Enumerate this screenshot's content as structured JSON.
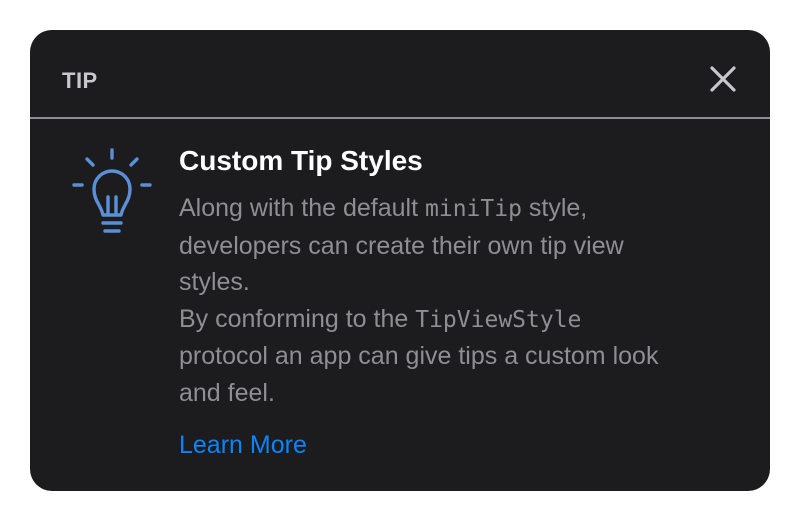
{
  "tip": {
    "header_label": "TIP",
    "close_icon": "close-icon",
    "icon": "lightbulb-icon",
    "title": "Custom Tip Styles",
    "body": {
      "p1_line1_pre": "Along with the default ",
      "p1_line1_code": "miniTip",
      "p1_line1_post": " style,",
      "p1_line2": "developers can create their own tip view",
      "p1_line3": "styles.",
      "p2_line1_pre": "By conforming to the ",
      "p2_line1_code": "TipViewStyle",
      "p2_line2": "protocol an app can give tips a custom look",
      "p2_line3": "and feel."
    },
    "action_label": "Learn More"
  },
  "colors": {
    "page_background": "#ffffff",
    "card_background": "#1c1c1e",
    "title": "#ffffff",
    "body_text": "#8e8e93",
    "header_label": "#c7c7cc",
    "divider": "#8e8e93",
    "icon": "#5b8fd6",
    "link": "#0a84ff"
  }
}
